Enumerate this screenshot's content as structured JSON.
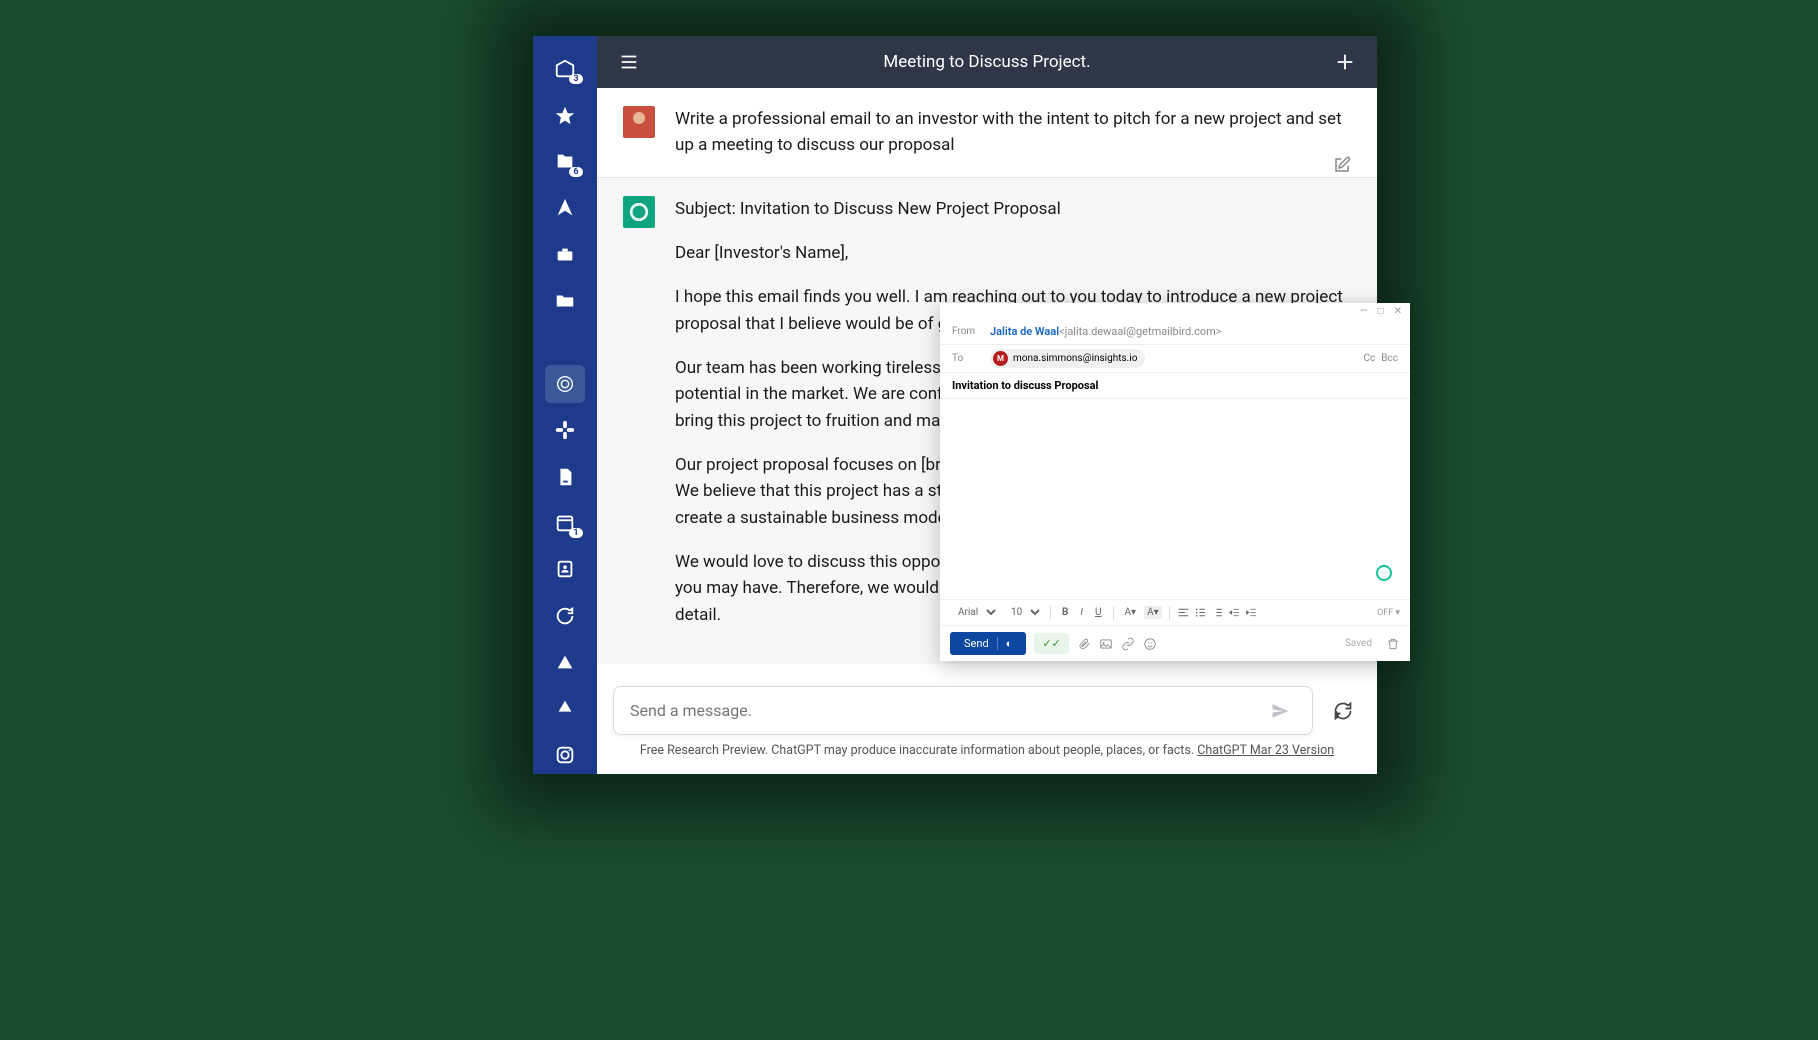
{
  "sidebar": {
    "inbox_badge": "3",
    "files_badge": "6",
    "cal_badge": "1"
  },
  "topbar": {
    "title": "Meeting to Discuss Project."
  },
  "user_msg": "Write a professional email to an investor with the intent to pitch for a new project and set up a meeting to discuss our proposal",
  "bot": {
    "subject": "Subject: Invitation to Discuss New Project Proposal",
    "p1": "Dear [Investor's Name],",
    "p2": "I hope this email finds you well. I am reaching out to you today to introduce a new project proposal that I believe would be of great interest to you.",
    "p3": "Our team has been working tirelessly to develop a new project that we believe has great potential in the market. We are confident that with your support and investment, we can bring this project to fruition and make it a success.",
    "p4": "Our project proposal focuses on [briefly describe the project and its potential benefits]. We believe that this project has a strong potential to generate significant returns and create a sustainable business model.",
    "p5": "We would love to discuss this opportunity with you in detail and answer any questions you may have. Therefore, we would like to invite you to a meeting to discuss our project in detail."
  },
  "input": {
    "placeholder": "Send a message."
  },
  "footer": {
    "text": "Free Research Preview. ChatGPT may produce inaccurate information about people, places, or facts. ",
    "link": "ChatGPT Mar 23 Version"
  },
  "compose": {
    "from_label": "From",
    "to_label": "To",
    "from_name": "Jalita de Waal",
    "from_email": " <jalita.dewaal@getmailbird.com>",
    "to_initial": "M",
    "to_email": "mona.simmons@insights.io",
    "cc": "Cc",
    "bcc": "Bcc",
    "subject": "Invitation to discuss Proposal",
    "font": "Arial",
    "size": "10",
    "off": "OFF",
    "send": "Send",
    "saved": "Saved"
  }
}
